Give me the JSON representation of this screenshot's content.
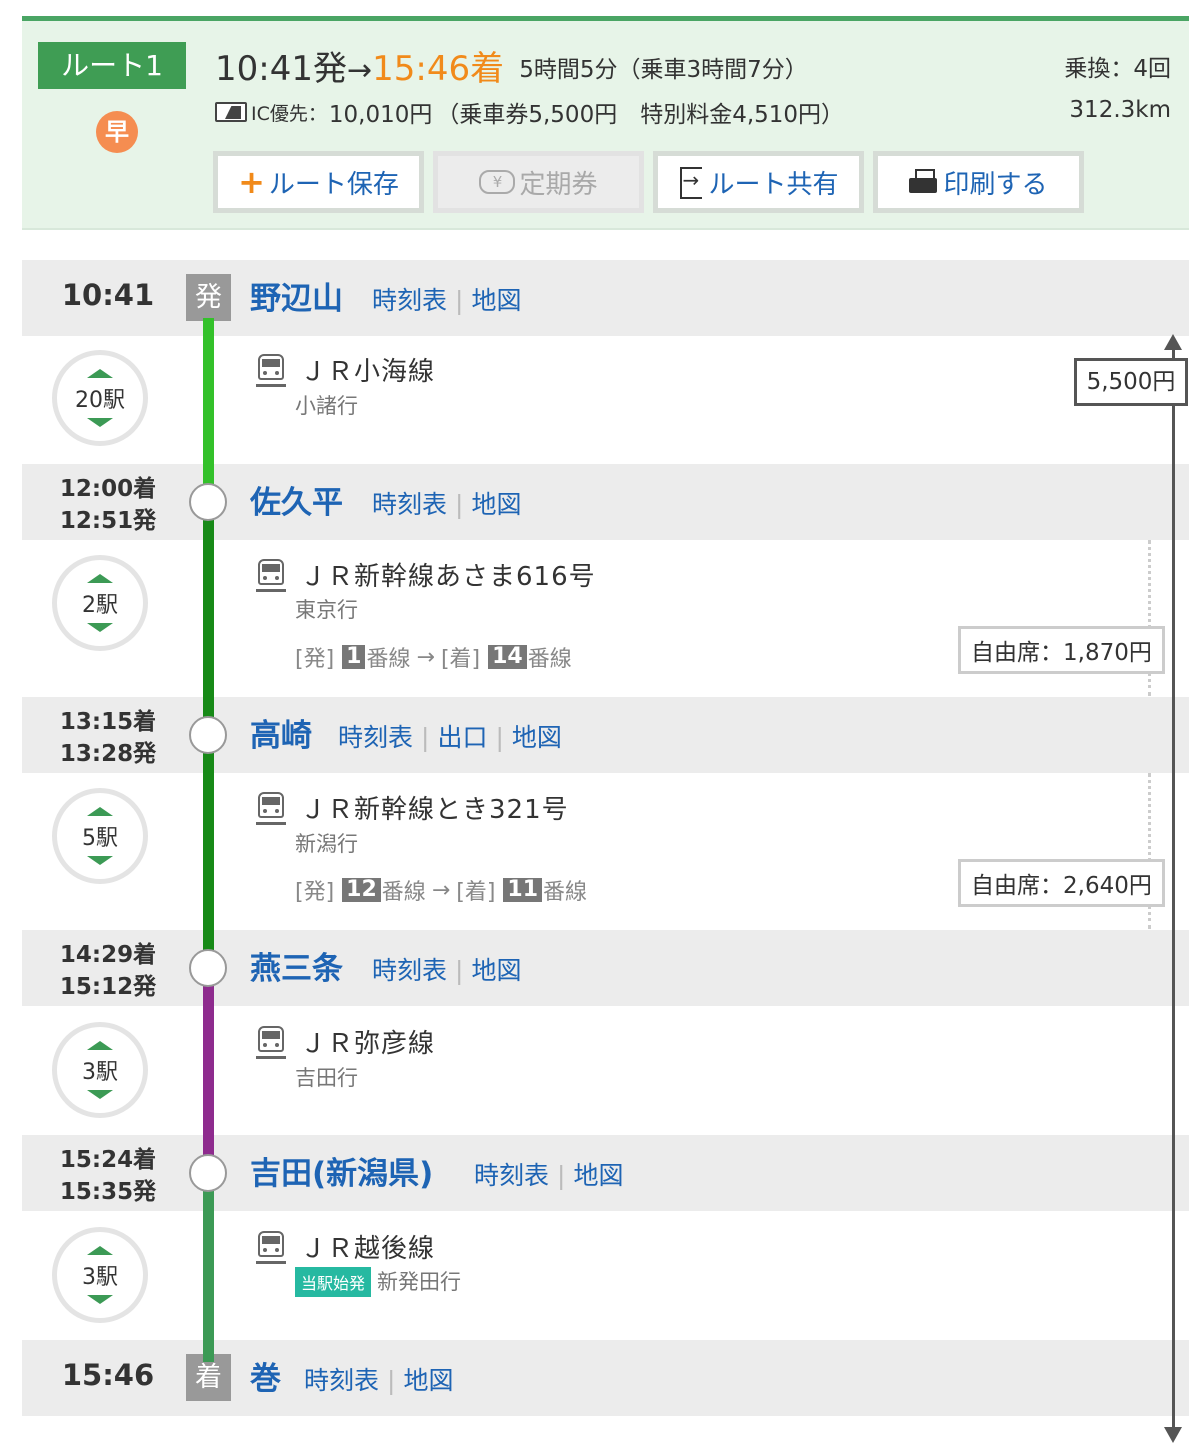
{
  "summary": {
    "route_label": "ルート1",
    "fast_badge": "早",
    "departure": "10:41発",
    "arrow": "→",
    "arrival": "15:46着",
    "duration": "5時間5分（乗車3時間7分）",
    "fare_ic_label": "IC優先：",
    "fare_amount": "10,010円",
    "fare_detail": "（乗車券5,500円　特別料金4,510円）",
    "transfer": "乗換：4回",
    "distance": "312.3km",
    "buttons": {
      "save": "ルート保存",
      "teiki": "定期券",
      "share": "ルート共有",
      "print": "印刷する"
    }
  },
  "total_fare": "5,500円",
  "stations": [
    {
      "time": "10:41",
      "mark": "発",
      "name": "野辺山",
      "links": [
        "時刻表",
        "地図"
      ]
    },
    {
      "arr": "12:00着",
      "dep": "12:51発",
      "name": "佐久平",
      "links": [
        "時刻表",
        "地図"
      ]
    },
    {
      "arr": "13:15着",
      "dep": "13:28発",
      "name": "高崎",
      "links": [
        "時刻表",
        "出口",
        "地図"
      ]
    },
    {
      "arr": "14:29着",
      "dep": "15:12発",
      "name": "燕三条",
      "links": [
        "時刻表",
        "地図"
      ]
    },
    {
      "arr": "15:24着",
      "dep": "15:35発",
      "name": "吉田(新潟県)",
      "links": [
        "時刻表",
        "地図"
      ]
    },
    {
      "time": "15:46",
      "mark": "着",
      "name": "巻",
      "links": [
        "時刻表",
        "地図"
      ]
    }
  ],
  "segments": [
    {
      "stops": "20駅",
      "line": "ＪＲ小海線",
      "dest": "小諸行",
      "color": "#33c12a"
    },
    {
      "stops": "2駅",
      "line": "ＪＲ新幹線あさま616号",
      "dest": "東京行",
      "plat_dep_label": "[発]",
      "plat_dep": "1",
      "plat_arr_label": "[着]",
      "plat_arr": "14",
      "plat_suffix": "番線",
      "plat_arrow": "→",
      "fare": "自由席：1,870円",
      "color": "#178a17"
    },
    {
      "stops": "5駅",
      "line": "ＪＲ新幹線とき321号",
      "dest": "新潟行",
      "plat_dep_label": "[発]",
      "plat_dep": "12",
      "plat_arr_label": "[着]",
      "plat_arr": "11",
      "plat_suffix": "番線",
      "plat_arrow": "→",
      "fare": "自由席：2,640円",
      "color": "#178a17"
    },
    {
      "stops": "3駅",
      "line": "ＪＲ弥彦線",
      "dest": "吉田行",
      "color": "#8e2b8e"
    },
    {
      "stops": "3駅",
      "line": "ＪＲ越後線",
      "badge": "当駅始発",
      "dest": "新発田行",
      "color": "#3c9a55"
    }
  ]
}
